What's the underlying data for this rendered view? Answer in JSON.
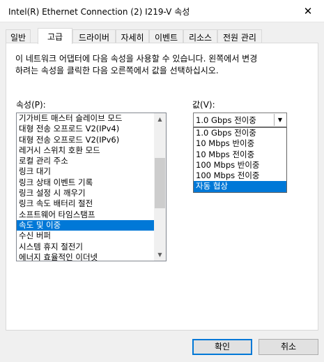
{
  "window": {
    "title": "Intel(R) Ethernet Connection (2) I219-V 속성",
    "close_glyph": "✕"
  },
  "tabs": [
    {
      "label": "일반"
    },
    {
      "label": "고급"
    },
    {
      "label": "드라이버"
    },
    {
      "label": "자세히"
    },
    {
      "label": "이벤트"
    },
    {
      "label": "리소스"
    },
    {
      "label": "전원 관리"
    }
  ],
  "active_tab": "고급",
  "description": {
    "line1": "이 네트워크 어댑터에 다음 속성을 사용할 수 있습니다. 왼쪽에서 변경",
    "line2": "하려는 속성을 클릭한 다음 오른쪽에서 값을 선택하십시오."
  },
  "properties": {
    "label": "속성(P):",
    "items": [
      "기가비트 매스터 슬레이브 모드",
      "대형 전송 오프로드 V2(IPv4)",
      "대형 전송 오프로드 V2(IPv6)",
      "레거시 스위치 호환 모드",
      "로컬 관리 주소",
      "링크 대기",
      "링크 상태 이벤트 기록",
      "링크 설정 시 깨우기",
      "링크 속도 배터리 절전",
      "소프트웨어 타임스탬프",
      "속도 및 이중",
      "수신 버퍼",
      "시스템 휴지 절전기",
      "에너지 효율적인 이더넷"
    ],
    "selected": "속도 및 이중",
    "scroll_up_glyph": "▲",
    "scroll_down_glyph": "▼"
  },
  "value": {
    "label": "값(V):",
    "current": "1.0 Gbps 전이중",
    "arrow_glyph": "▼",
    "options": [
      "1.0 Gbps 전이중",
      "10 Mbps 반이중",
      "10 Mbps 전이중",
      "100 Mbps 반이중",
      "100 Mbps 전이중",
      "자동 협상"
    ],
    "highlighted": "자동 협상"
  },
  "buttons": {
    "ok": "확인",
    "cancel": "취소"
  },
  "colors": {
    "selection": "#0078d7",
    "window_bg": "#f0f0f0",
    "panel_bg": "#ffffff"
  }
}
